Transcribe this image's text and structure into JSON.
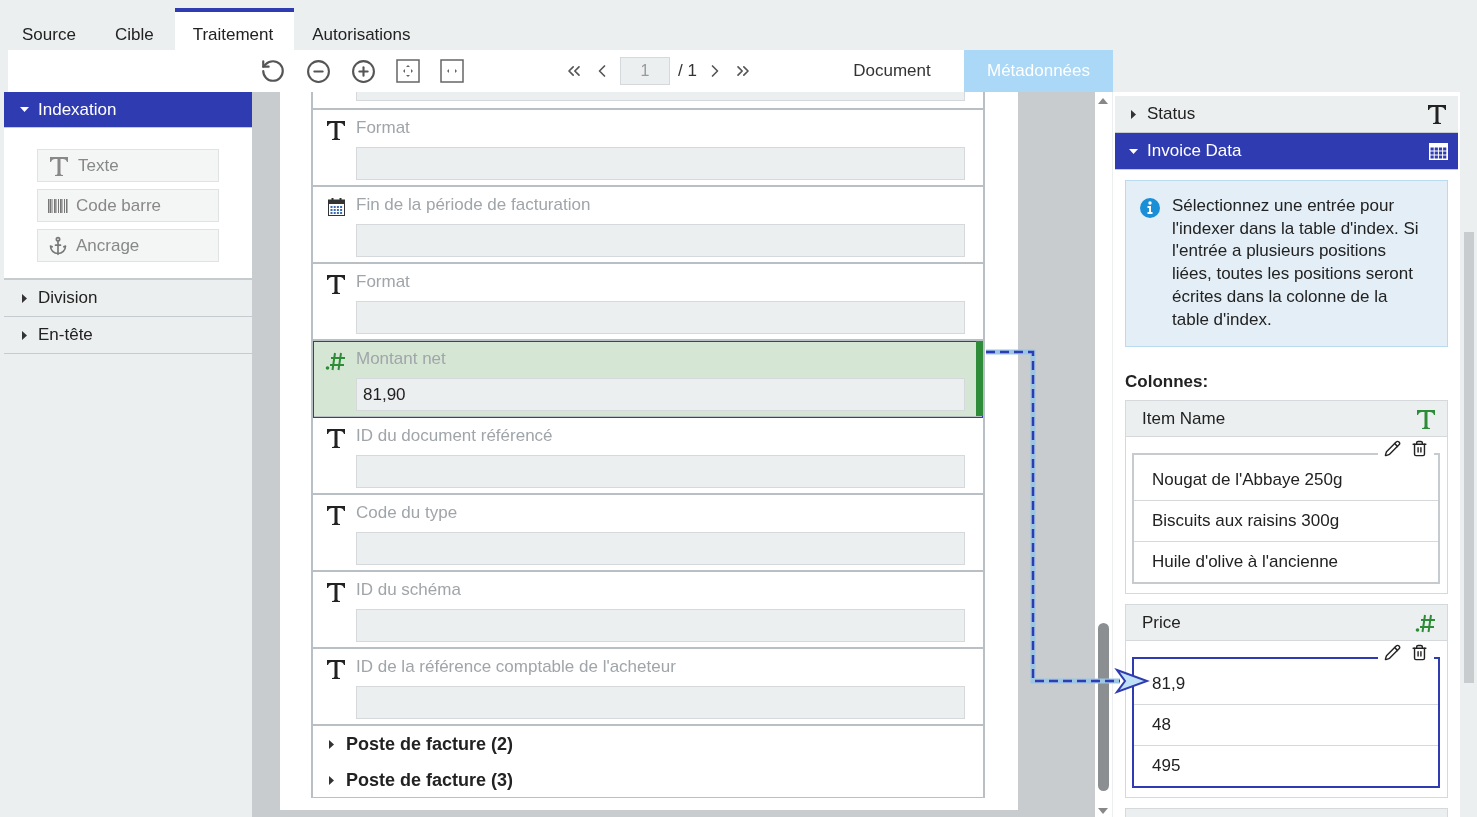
{
  "tabs": [
    {
      "label": "Source",
      "selected": false
    },
    {
      "label": "Cible",
      "selected": false
    },
    {
      "label": "Traitement",
      "selected": true
    },
    {
      "label": "Autorisations",
      "selected": false
    }
  ],
  "toolbar": {
    "page_input": "1",
    "page_total": "/ 1",
    "views": [
      {
        "label": "Document",
        "selected": false
      },
      {
        "label": "Métadonnées",
        "selected": true
      }
    ]
  },
  "sidebar": {
    "sections": [
      {
        "label": "Indexation",
        "expanded": true,
        "items": [
          {
            "kind": "text",
            "label": "Texte"
          },
          {
            "kind": "barcode",
            "label": "Code barre"
          },
          {
            "kind": "anchor",
            "label": "Ancrage"
          }
        ]
      },
      {
        "label": "Division",
        "expanded": false
      },
      {
        "label": "En-tête",
        "expanded": false
      }
    ]
  },
  "form": {
    "fields": [
      {
        "kind": "text",
        "label": "Format",
        "selected": false
      },
      {
        "kind": "date",
        "label": "Fin de la période de facturation",
        "selected": false
      },
      {
        "kind": "text",
        "label": "Format",
        "selected": false
      },
      {
        "kind": "number",
        "label": "Montant net",
        "value": "81,90",
        "selected": true
      },
      {
        "kind": "text",
        "label": "ID du document référencé",
        "selected": false
      },
      {
        "kind": "text",
        "label": "Code du type",
        "selected": false
      },
      {
        "kind": "text",
        "label": "ID du schéma",
        "selected": false
      },
      {
        "kind": "text",
        "label": "ID de la référence comptable de l'acheteur",
        "selected": false
      }
    ],
    "sections": [
      {
        "label": "Poste de facture (2)",
        "expanded": false
      },
      {
        "label": "Poste de facture (3)",
        "expanded": false
      }
    ]
  },
  "panel": {
    "sections": [
      {
        "label": "Status",
        "kind": "text",
        "expanded": false
      },
      {
        "label": "Invoice Data",
        "kind": "table",
        "expanded": true,
        "info": "Sélectionnez une entrée pour l'indexer dans la table d'index. Si l'entrée a plusieurs positions liées, toutes les positions seront écrites dans la colonne de la table d'index.",
        "columns_label": "Colonnes:",
        "columns": [
          {
            "name": "Item Name",
            "kind": "text",
            "selected": false,
            "values": [
              "Nougat de l'Abbaye 250g",
              "Biscuits aux raisins 300g",
              "Huile d'olive à l'ancienne"
            ]
          },
          {
            "name": "Price",
            "kind": "number",
            "selected": true,
            "values": [
              "81,9",
              "48",
              "495"
            ]
          }
        ]
      }
    ]
  }
}
